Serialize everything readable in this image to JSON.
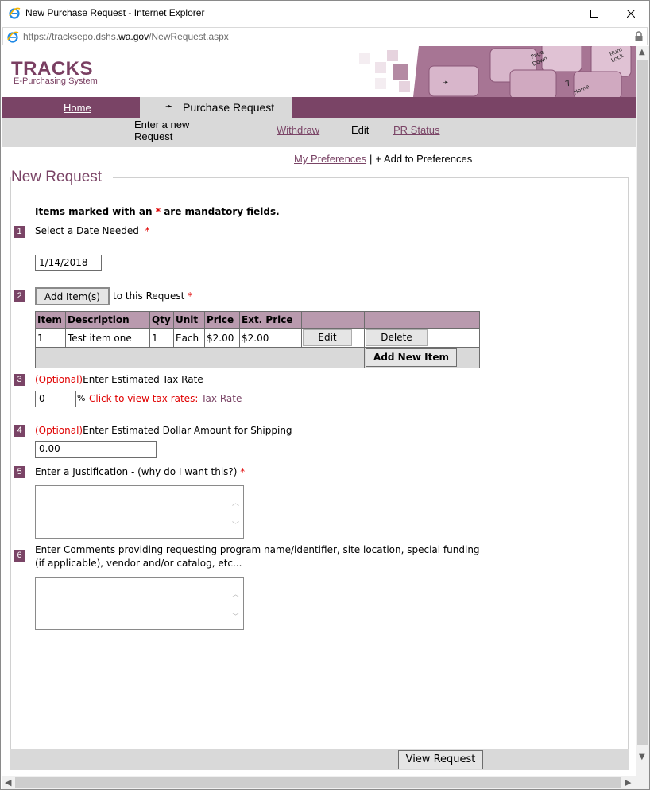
{
  "window": {
    "title": "New Purchase Request - Internet Explorer",
    "url_prefix": "https://tracksepo.dshs.",
    "url_domain": "wa.gov",
    "url_path": "/NewRequest.aspx"
  },
  "header": {
    "logo_title": "TRACKS",
    "logo_subtitle": "E-Purchasing System"
  },
  "nav": {
    "home": "Home",
    "active_arrow": "➛",
    "active_label": "Purchase Request",
    "sub": {
      "enter_line1": "Enter a new",
      "enter_line2": "Request",
      "withdraw": "Withdraw",
      "edit": "Edit",
      "status": "PR Status"
    }
  },
  "prefs": {
    "my_prefs": "My Preferences",
    "separator": "|",
    "add": "+ Add to Preferences"
  },
  "form": {
    "legend": "New Request",
    "mandatory_prefix": "Items marked with an ",
    "mandatory_star": "*",
    "mandatory_suffix": " are mandatory fields.",
    "steps": {
      "s1": {
        "num": "1",
        "label": "Select a Date Needed",
        "star": "*",
        "value": "1/14/2018"
      },
      "s2": {
        "num": "2",
        "button": "Add Item(s)",
        "label": "to this Request",
        "star": "*"
      },
      "s3": {
        "num": "3",
        "optional": "(Optional)",
        "label": "Enter Estimated Tax Rate",
        "value": "0",
        "pct": "%",
        "click_text": "Click to view tax rates:",
        "link": "Tax Rate"
      },
      "s4": {
        "num": "4",
        "optional": "(Optional)",
        "label": "Enter Estimated Dollar Amount for Shipping",
        "value": "0.00"
      },
      "s5": {
        "num": "5",
        "label": "Enter a Justification - (why do I want this?)",
        "star": "*",
        "value": ""
      },
      "s6": {
        "num": "6",
        "label_line1": "Enter Comments providing requesting program name/identifier, site location, special funding",
        "label_line2": "(if applicable), vendor and/or catalog, etc...",
        "value": ""
      }
    },
    "table": {
      "headers": [
        "Item",
        "Description",
        "Qty",
        "Unit",
        "Price",
        "Ext. Price",
        "",
        ""
      ],
      "rows": [
        {
          "item": "1",
          "description": "Test item one",
          "qty": "1",
          "unit": "Each",
          "price": "$2.00",
          "ext_price": "$2.00",
          "edit": "Edit",
          "delete": "Delete"
        }
      ],
      "add_new": "Add New Item"
    },
    "view_request": "View Request"
  }
}
